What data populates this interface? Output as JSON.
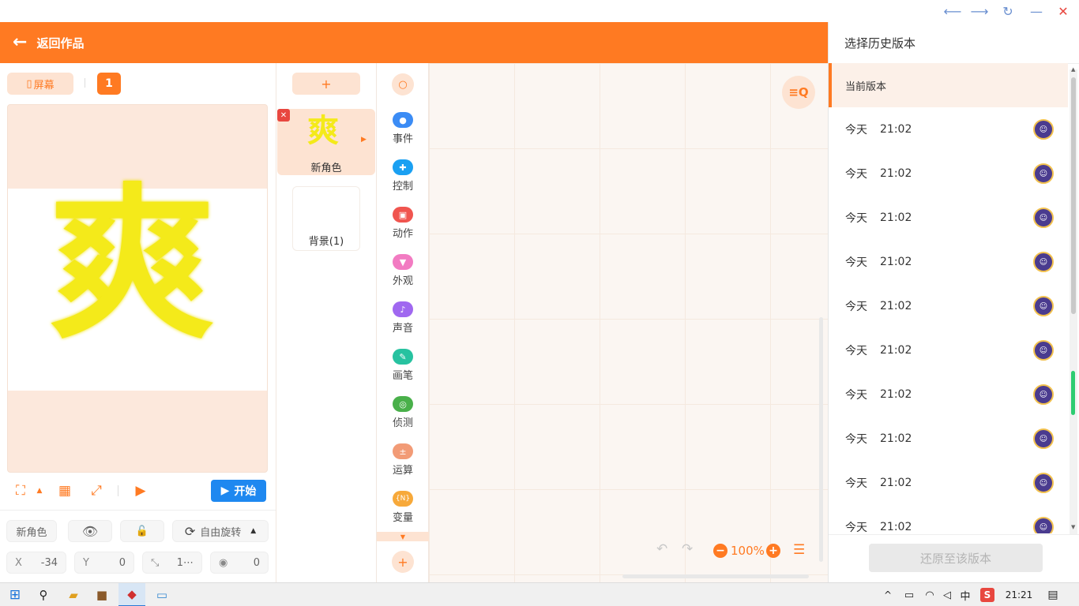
{
  "header": {
    "back_label": "返回作品"
  },
  "stage_toolbar": {
    "screen_label": "屏幕",
    "page_number": "1"
  },
  "stage": {
    "sprite_char": "爽",
    "sprite_color": "#f4ea1a"
  },
  "stage_controls": {
    "start_label": "开始"
  },
  "sprite_props": {
    "name": "新角色",
    "rotation_label": "自由旋转",
    "x_label": "X",
    "x_value": "-34",
    "y_label": "Y",
    "y_value": "0",
    "size_value": "1⋯",
    "direction_value": "0"
  },
  "sprites": {
    "add_label": "+",
    "items": [
      {
        "name": "新角色",
        "char": "爽"
      }
    ],
    "background_label": "背景(1)"
  },
  "categories": [
    {
      "label": "事件",
      "color": "#3b8cf5"
    },
    {
      "label": "控制",
      "color": "#1aa0f2"
    },
    {
      "label": "动作",
      "color": "#f0554f"
    },
    {
      "label": "外观",
      "color": "#f27bc2"
    },
    {
      "label": "声音",
      "color": "#a068f0"
    },
    {
      "label": "画笔",
      "color": "#27c2a0"
    },
    {
      "label": "侦测",
      "color": "#49b04a"
    },
    {
      "label": "运算",
      "color": "#f29b76"
    },
    {
      "label": "变量",
      "color": "#f7a93a"
    }
  ],
  "workspace": {
    "zoom": "100%"
  },
  "history": {
    "title": "选择历史版本",
    "current_label": "当前版本",
    "versions": [
      {
        "day": "今天",
        "time": "21:02"
      },
      {
        "day": "今天",
        "time": "21:02"
      },
      {
        "day": "今天",
        "time": "21:02"
      },
      {
        "day": "今天",
        "time": "21:02"
      },
      {
        "day": "今天",
        "time": "21:02"
      },
      {
        "day": "今天",
        "time": "21:02"
      },
      {
        "day": "今天",
        "time": "21:02"
      },
      {
        "day": "今天",
        "time": "21:02"
      },
      {
        "day": "今天",
        "time": "21:02"
      },
      {
        "day": "今天",
        "time": "21:02"
      }
    ],
    "restore_label": "还原至该版本"
  },
  "taskbar": {
    "ime_label": "中",
    "clock": "21:21"
  },
  "colors": {
    "accent": "#ff7a22",
    "start_button": "#1e88f0"
  }
}
